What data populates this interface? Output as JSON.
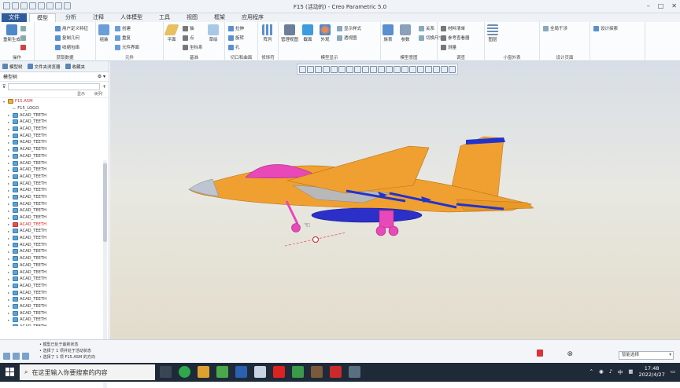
{
  "window": {
    "title": "F15 (活动的) - Creo Parametric 5.0"
  },
  "tabs": [
    "文件",
    "模型",
    "分析",
    "注释",
    "人体模型",
    "工具",
    "视图",
    "框架",
    "应用程序"
  ],
  "active_tab": "模型",
  "ribbon": {
    "groups": [
      {
        "label": "操作"
      },
      {
        "label": "获取数据"
      },
      {
        "label": "元件"
      },
      {
        "label": "基准"
      },
      {
        "label": "切口和曲面"
      },
      {
        "label": "修饰符"
      },
      {
        "label": "模型显示"
      },
      {
        "label": "模型意图"
      },
      {
        "label": "调查"
      },
      {
        "label": "小窗外表"
      },
      {
        "label": "设计页面"
      }
    ],
    "buttons": {
      "regenerate": "重新生成",
      "user_defined": "用户定义特征",
      "copy_geometry": "复制几何",
      "shrinkwrap": "收缩包络",
      "assemble": "组装",
      "create": "创建",
      "repeat": "重复",
      "component_interface": "元件界面",
      "plane": "平面",
      "axis": "轴",
      "point": "点",
      "coordinate_system": "坐标系",
      "sketch": "草绘",
      "extrude": "拉伸",
      "revolve": "旋转",
      "hole": "孔",
      "pattern": "阵列",
      "manage_views": "管理视图",
      "section": "截面",
      "appearance": "外观",
      "display_style": "显示样式",
      "perspective": "透视图",
      "parameters": "参数",
      "relations": "关系",
      "switch_dims": "切换尺寸",
      "family_table": "族表",
      "bill_of_materials": "材料清单",
      "reference_viewer": "参考查看器",
      "measure": "测量",
      "global_interference": "全局干涉",
      "layers": "图层",
      "design_exploration": "设计探索"
    }
  },
  "model_tree": {
    "tabs": [
      "模型树",
      "文件夹浏览器",
      "收藏夹"
    ],
    "header": "模型树",
    "column_header": "显示",
    "column_header2": "树列",
    "root": "F15.ASM",
    "first_child": "F15_LOGO",
    "items": [
      {
        "label": "ACAD_TEETH",
        "error": false
      },
      {
        "label": "ACAD_TEETH",
        "error": false
      },
      {
        "label": "ACAD_TEETH",
        "error": false
      },
      {
        "label": "ACAD_TEETH",
        "error": false
      },
      {
        "label": "ACAD_TEETH",
        "error": false
      },
      {
        "label": "ACAD_TEETH",
        "error": false
      },
      {
        "label": "ACAD_TEETH",
        "error": false
      },
      {
        "label": "ACAD_TEETH",
        "error": false
      },
      {
        "label": "ACAD_TEETH",
        "error": false
      },
      {
        "label": "ACAD_TEETH",
        "error": false
      },
      {
        "label": "ACAD_TEETH",
        "error": false
      },
      {
        "label": "ACAD_TEETH",
        "error": false
      },
      {
        "label": "ACAD_TEETH",
        "error": false
      },
      {
        "label": "ACAD_TEETH",
        "error": false
      },
      {
        "label": "ACAD_TEETH",
        "error": false
      },
      {
        "label": "ACAD_TEETH",
        "error": false
      },
      {
        "label": "ACAD_TEETH",
        "error": true
      },
      {
        "label": "ACAD_TEETH",
        "error": false
      },
      {
        "label": "ACAD_TEETH",
        "error": false
      },
      {
        "label": "ACAD_TEETH",
        "error": false
      },
      {
        "label": "ACAD_TEETH",
        "error": false
      },
      {
        "label": "ACAD_TEETH",
        "error": false
      },
      {
        "label": "ACAD_TEETH",
        "error": false
      },
      {
        "label": "ACAD_TEETH",
        "error": false
      },
      {
        "label": "ACAD_TEETH",
        "error": false
      },
      {
        "label": "ACAD_TEETH",
        "error": false
      },
      {
        "label": "ACAD_TEETH",
        "error": false
      },
      {
        "label": "ACAD_TEETH",
        "error": false
      },
      {
        "label": "ACAD_TEETH",
        "error": false
      },
      {
        "label": "ACAD_TEETH",
        "error": false
      },
      {
        "label": "ACAD_TEETH",
        "error": false
      },
      {
        "label": "ACAD_TEETH",
        "error": false
      }
    ]
  },
  "status": {
    "messages": [
      "• 模型已处于最新状态",
      "• 选择了 1 项并处于活动状态",
      "• 选择了 1 项 F15.ASM 的方向"
    ],
    "filter": "智能选择"
  },
  "taskbar": {
    "search_placeholder": "在这里输入你要搜索的内容",
    "time": "17:48",
    "date": "2022/4/27",
    "ime": "中"
  },
  "colors": {
    "fuselage": "#f0a030",
    "canopy": "#e848b8",
    "missiles": "#2233cc",
    "intake": "#b8b8b8",
    "gear": "#e848b8"
  }
}
